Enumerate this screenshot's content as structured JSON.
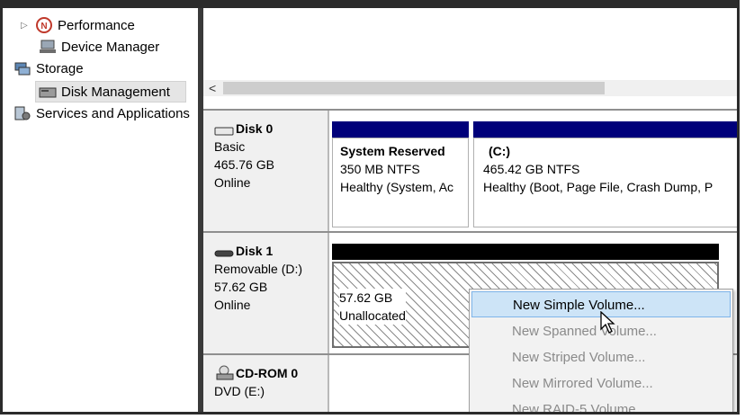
{
  "tree": {
    "items": [
      {
        "label": "Performance",
        "icon": "performance-icon"
      },
      {
        "label": "Device Manager",
        "icon": "device-manager-icon"
      },
      {
        "label": "Storage",
        "icon": "storage-icon"
      },
      {
        "label": "Disk Management",
        "icon": "disk-management-icon",
        "selected": true
      },
      {
        "label": "Services and Applications",
        "icon": "services-icon"
      }
    ]
  },
  "scrollbar": {
    "left_arrow": "<"
  },
  "disks": [
    {
      "name": "Disk 0",
      "type": "Basic",
      "size": "465.76 GB",
      "status": "Online",
      "volumes": [
        {
          "title": "System Reserved",
          "line1": "350 MB NTFS",
          "line2": "Healthy (System, Ac"
        },
        {
          "title": "(C:)",
          "line1": "465.42 GB NTFS",
          "line2": "Healthy (Boot, Page File, Crash Dump, P"
        }
      ]
    },
    {
      "name": "Disk 1",
      "type": "Removable (D:)",
      "size": "57.62 GB",
      "status": "Online",
      "volumes": [
        {
          "title": "",
          "line1": "57.62 GB",
          "line2": "Unallocated"
        }
      ]
    },
    {
      "name": "CD-ROM 0",
      "type": "DVD (E:)",
      "size": "",
      "status": ""
    }
  ],
  "context_menu": {
    "items": [
      {
        "label": "New Simple Volume...",
        "enabled": true
      },
      {
        "label": "New Spanned Volume...",
        "enabled": false
      },
      {
        "label": "New Striped Volume...",
        "enabled": false
      },
      {
        "label": "New Mirrored Volume...",
        "enabled": false
      },
      {
        "label": "New RAID-5 Volume...",
        "enabled": false
      }
    ]
  },
  "colors": {
    "primary_partition_band": "#00007a",
    "unallocated_band": "#000000",
    "menu_highlight": "#cde4f7"
  }
}
